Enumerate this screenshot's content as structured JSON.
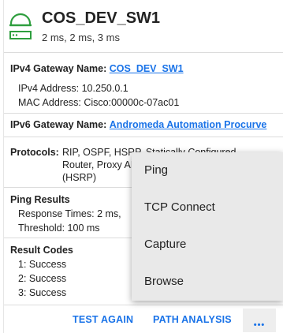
{
  "device": {
    "name": "COS_DEV_SW1",
    "response_times": "2 ms,  2 ms,  3 ms",
    "icon": "router-icon"
  },
  "ipv4": {
    "gateway_label": "IPv4 Gateway Name:",
    "gateway_value": "COS_DEV_SW1",
    "address_label": "IPv4 Address:",
    "address_value": "10.250.0.1",
    "mac_label": "MAC Address:",
    "mac_value": "Cisco:00000c-07ac01"
  },
  "ipv6": {
    "gateway_label": "IPv6 Gateway Name:",
    "gateway_value": "Andromeda Automation Procurve"
  },
  "protocols": {
    "label": "Protocols:",
    "line1": "RIP, OSPF, HSRP, Statically Configured",
    "line2": "Router, Proxy ARP",
    "line3": "(HSRP)"
  },
  "ping_results": {
    "title": "Ping Results",
    "response_label": "Response Times:",
    "response_value": "2 ms,",
    "threshold_label": "Threshold:",
    "threshold_value": "100 ms"
  },
  "result_codes": {
    "title": "Result Codes",
    "items": [
      "1: Success",
      "2: Success",
      "3: Success"
    ]
  },
  "actions": {
    "test_again": "TEST AGAIN",
    "path_analysis": "PATH ANALYSIS",
    "more": "•••"
  },
  "menu": {
    "items": [
      "Ping",
      "TCP Connect",
      "Capture",
      "Browse"
    ]
  },
  "colors": {
    "accent": "#1a73e8",
    "icon_green": "#2e9e3e",
    "menu_bg": "#e9e9e9"
  }
}
